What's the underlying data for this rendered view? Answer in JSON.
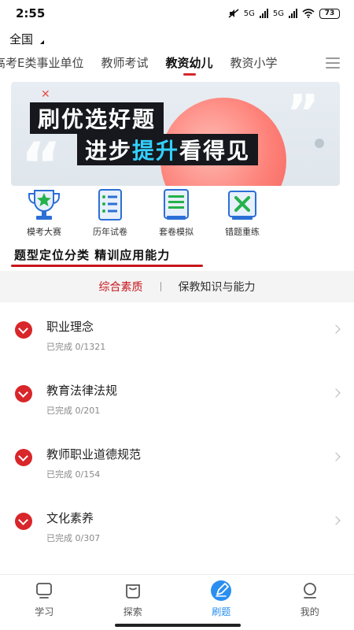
{
  "status": {
    "time": "2:55",
    "network1": "5G",
    "network2": "5G",
    "battery": "73"
  },
  "region": {
    "label": "全国"
  },
  "category_tabs": [
    {
      "label": "高考E类事业单位"
    },
    {
      "label": "教师考试"
    },
    {
      "label": "教资幼儿",
      "active": true
    },
    {
      "label": "教资小学"
    }
  ],
  "banner": {
    "line1": "刷优选好题",
    "line2_a": "进步",
    "line2_b": "提升",
    "line2_c": "看得见"
  },
  "features": [
    {
      "label": "模考大赛",
      "icon": "trophy-icon"
    },
    {
      "label": "历年试卷",
      "icon": "past-papers-icon"
    },
    {
      "label": "套卷模拟",
      "icon": "mock-paper-icon"
    },
    {
      "label": "错题重练",
      "icon": "wrong-questions-icon"
    }
  ],
  "section": {
    "title": "题型定位分类 精训应用能力"
  },
  "subject_tabs": [
    {
      "label": "综合素质",
      "active": true
    },
    {
      "label": "保教知识与能力"
    }
  ],
  "topics": [
    {
      "title": "职业理念",
      "progress": "已完成 0/1321"
    },
    {
      "title": "教育法律法规",
      "progress": "已完成 0/201"
    },
    {
      "title": "教师职业道德规范",
      "progress": "已完成 0/154"
    },
    {
      "title": "文化素养",
      "progress": "已完成 0/307"
    }
  ],
  "bottom_nav": [
    {
      "label": "学习",
      "icon": "study-icon"
    },
    {
      "label": "探索",
      "icon": "explore-icon"
    },
    {
      "label": "刷题",
      "icon": "practice-icon",
      "active": true
    },
    {
      "label": "我的",
      "icon": "profile-icon"
    }
  ],
  "colors": {
    "accent_red": "#d8262b",
    "active_blue": "#2a8ff0",
    "banner_highlight": "#33d0ff"
  }
}
